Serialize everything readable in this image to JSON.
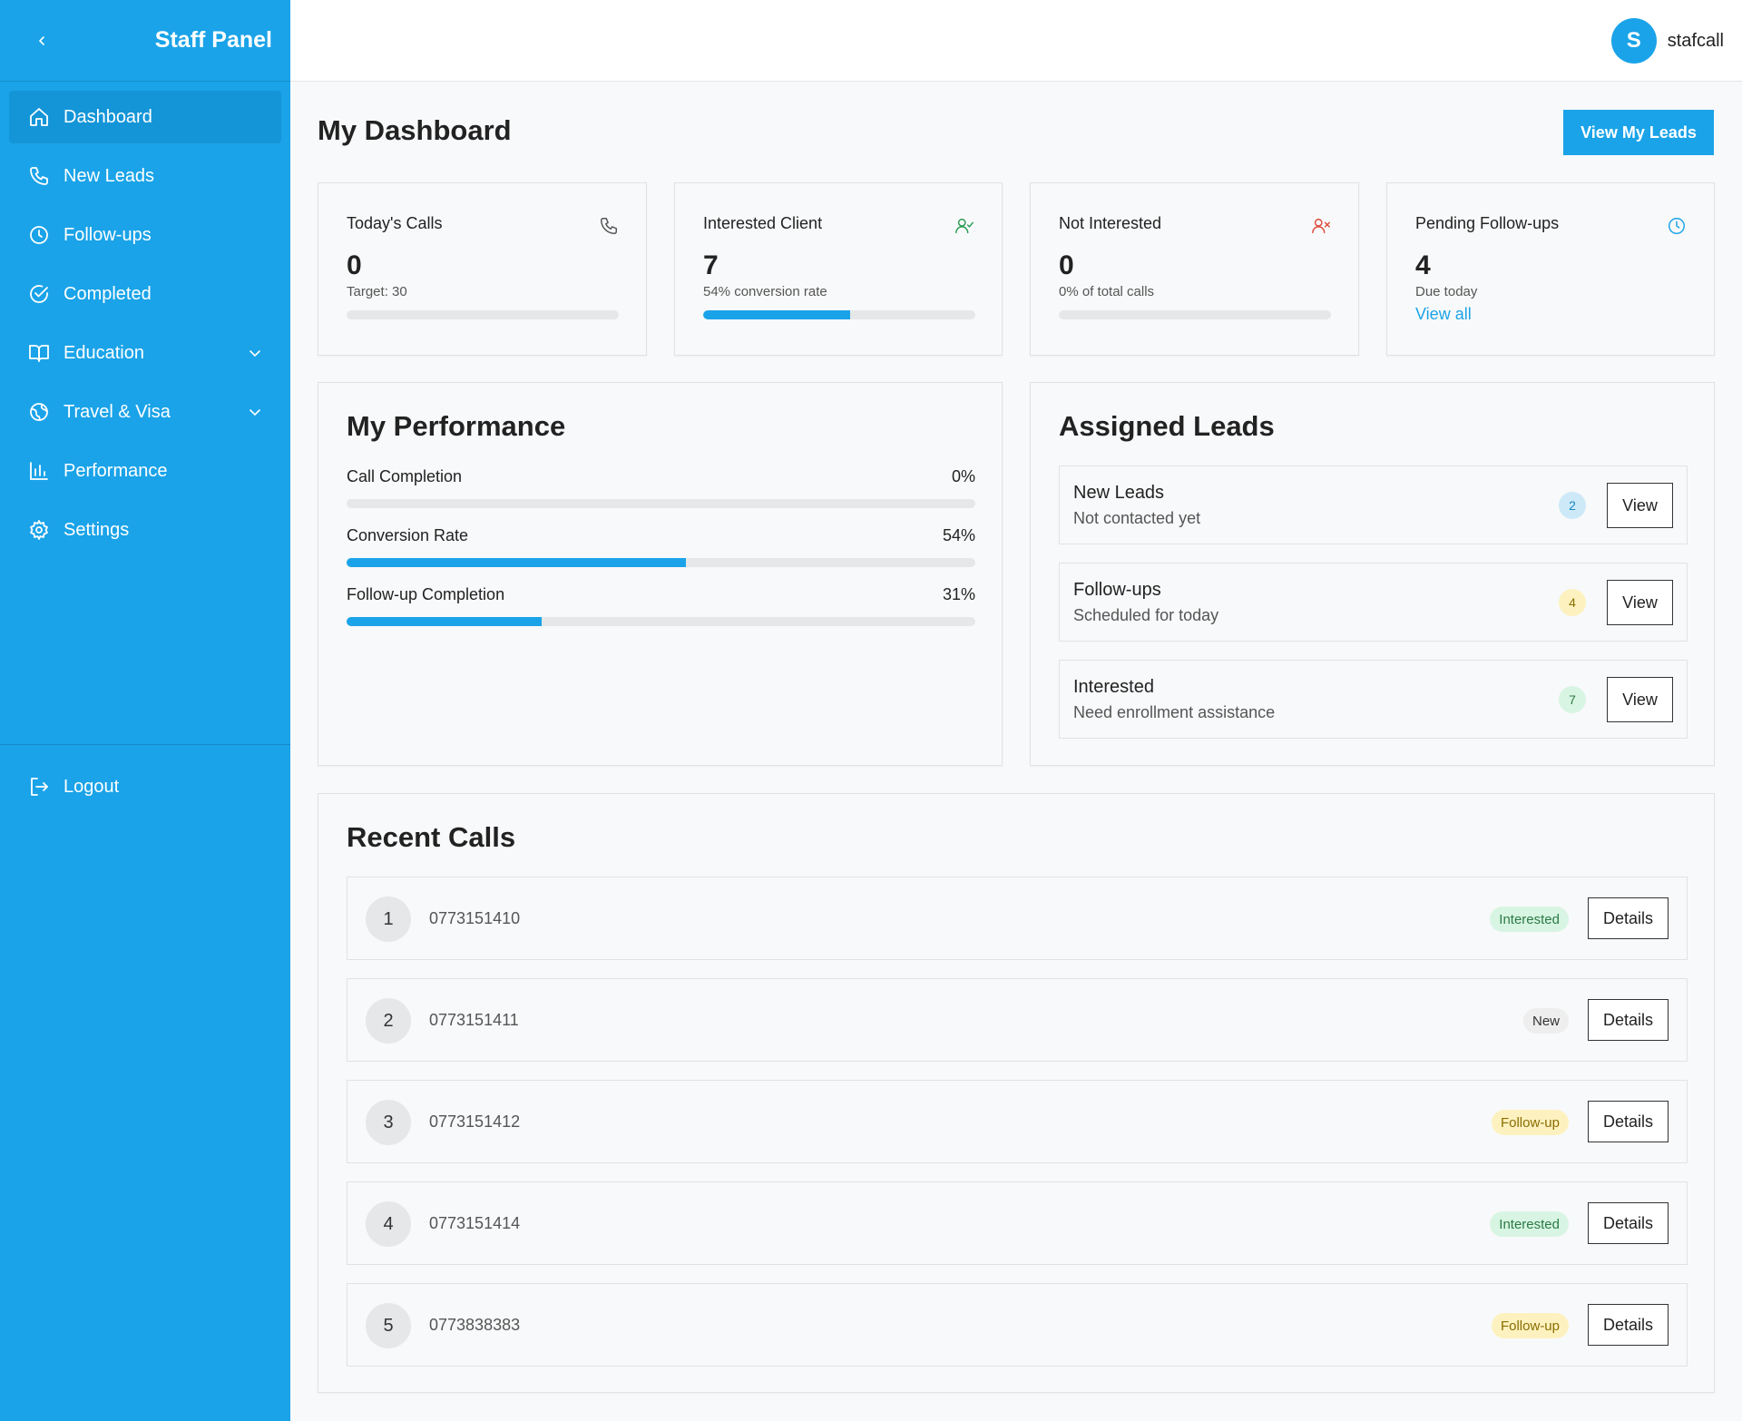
{
  "sidebar": {
    "title": "Staff Panel",
    "items": [
      {
        "label": "Dashboard",
        "icon": "home-icon"
      },
      {
        "label": "New Leads",
        "icon": "phone-icon"
      },
      {
        "label": "Follow-ups",
        "icon": "clock-icon"
      },
      {
        "label": "Completed",
        "icon": "check-circle-icon"
      },
      {
        "label": "Education",
        "icon": "book-icon"
      },
      {
        "label": "Travel & Visa",
        "icon": "globe-icon"
      },
      {
        "label": "Performance",
        "icon": "bar-chart-icon"
      },
      {
        "label": "Settings",
        "icon": "gear-icon"
      }
    ],
    "logout_label": "Logout"
  },
  "topbar": {
    "avatar_initial": "S",
    "username": "stafcall"
  },
  "page": {
    "title": "My Dashboard",
    "view_leads_label": "View My Leads"
  },
  "stats": [
    {
      "label": "Today's Calls",
      "value": "0",
      "sub": "Target: 30",
      "progress": 0,
      "icon": "phone-icon"
    },
    {
      "label": "Interested Client",
      "value": "7",
      "sub": "54% conversion rate",
      "progress": 0.54,
      "icon": "user-check-icon"
    },
    {
      "label": "Not Interested",
      "value": "0",
      "sub": "0% of total calls",
      "progress": 0,
      "icon": "user-x-icon"
    },
    {
      "label": "Pending Follow-ups",
      "value": "4",
      "sub": "Due today",
      "link": "View all",
      "icon": "clock-icon"
    }
  ],
  "performance": {
    "title": "My Performance",
    "rows": [
      {
        "label": "Call Completion",
        "value": "0%",
        "progress": 0
      },
      {
        "label": "Conversion Rate",
        "value": "54%",
        "progress": 0.54
      },
      {
        "label": "Follow-up Completion",
        "value": "31%",
        "progress": 0.31
      }
    ]
  },
  "assigned": {
    "title": "Assigned Leads",
    "view_label": "View",
    "rows": [
      {
        "title": "New Leads",
        "subtitle": "Not contacted yet",
        "count": "2",
        "badge_bg": "#cde9f8",
        "badge_fg": "#1a86c4"
      },
      {
        "title": "Follow-ups",
        "subtitle": "Scheduled for today",
        "count": "4",
        "badge_bg": "#fdf2bf",
        "badge_fg": "#8a6d00"
      },
      {
        "title": "Interested",
        "subtitle": "Need enrollment assistance",
        "count": "7",
        "badge_bg": "#d8f5e3",
        "badge_fg": "#2a7a44"
      }
    ]
  },
  "recent": {
    "title": "Recent Calls",
    "details_label": "Details",
    "rows": [
      {
        "num": "1",
        "phone": "0773151410",
        "status": "Interested",
        "status_bg": "#d8f5e3",
        "status_fg": "#2a7a44"
      },
      {
        "num": "2",
        "phone": "0773151411",
        "status": "New",
        "status_bg": "#eeeeee",
        "status_fg": "#333333"
      },
      {
        "num": "3",
        "phone": "0773151412",
        "status": "Follow-up",
        "status_bg": "#fdf2bf",
        "status_fg": "#8a6d00"
      },
      {
        "num": "4",
        "phone": "0773151414",
        "status": "Interested",
        "status_bg": "#d8f5e3",
        "status_fg": "#2a7a44"
      },
      {
        "num": "5",
        "phone": "0773838383",
        "status": "Follow-up",
        "status_bg": "#fdf2bf",
        "status_fg": "#8a6d00"
      }
    ]
  },
  "colors": {
    "accent": "#1aa3e8",
    "green": "#2a9d55",
    "red": "#e04b3a"
  }
}
